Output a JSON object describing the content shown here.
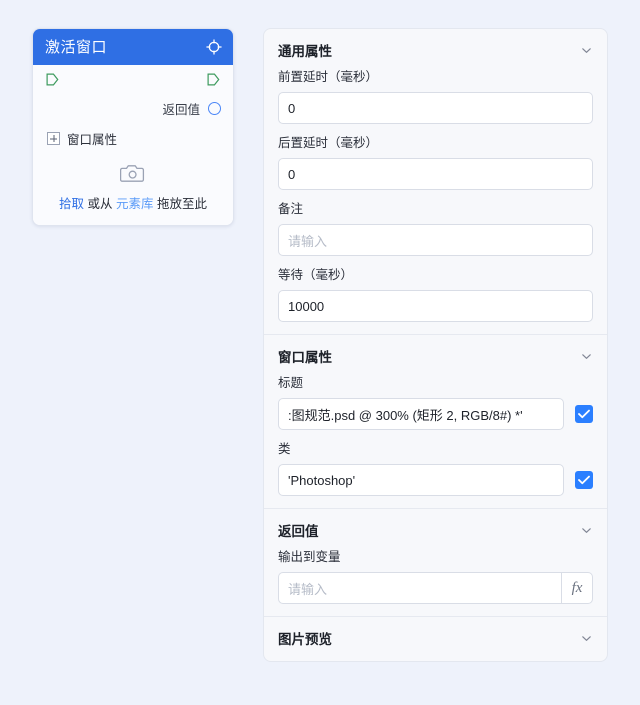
{
  "node": {
    "title": "激活窗口",
    "header_icon": "crosshair-target-icon",
    "return_label": "返回值",
    "window_props_label": "窗口属性",
    "drop_hint": {
      "pick": "拾取",
      "middle": "或从",
      "library": "元素库",
      "tail": "拖放至此"
    },
    "camera_icon": "camera-icon"
  },
  "panel": {
    "sections": [
      {
        "title": "通用属性",
        "fields": [
          {
            "label": "前置延时（毫秒）",
            "value": "0",
            "placeholder": ""
          },
          {
            "label": "后置延时（毫秒）",
            "value": "0",
            "placeholder": ""
          },
          {
            "label": "备注",
            "value": "",
            "placeholder": "请输入"
          },
          {
            "label": "等待（毫秒）",
            "value": "10000",
            "placeholder": ""
          }
        ]
      },
      {
        "title": "窗口属性",
        "fields": [
          {
            "label": "标题",
            "value": ":图规范.psd @ 300% (矩形 2, RGB/8#) *'",
            "checked": true
          },
          {
            "label": "类",
            "value": "'Photoshop'",
            "checked": true
          }
        ]
      },
      {
        "title": "返回值",
        "fields": [
          {
            "label": "输出到变量",
            "value": "",
            "placeholder": "请输入",
            "fx": "fx"
          }
        ]
      },
      {
        "title": "图片预览",
        "fields": []
      }
    ]
  },
  "colors": {
    "accent": "#2f6fe4",
    "checkbox": "#2b7fff",
    "page_bg": "#eef2fb",
    "panel_bg": "#f7f8fb",
    "flow_port": "#3e9b5f",
    "return_port": "#4a86f7"
  }
}
